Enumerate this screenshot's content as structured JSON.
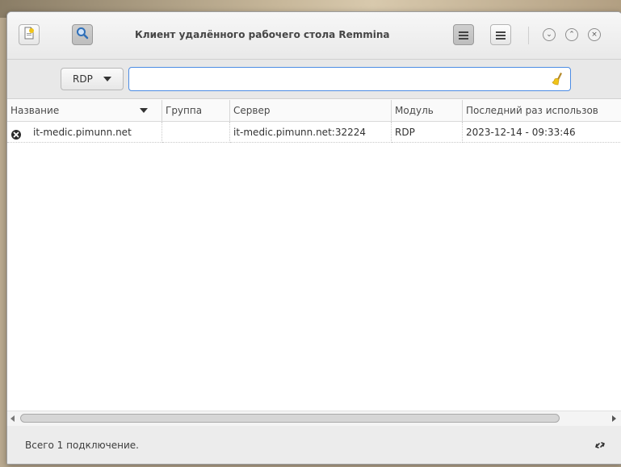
{
  "window": {
    "title": "Клиент удалённого рабочего стола Remmina"
  },
  "headerbar": {
    "new_connection_icon": "new-document-icon",
    "search_toggle_icon": "search-icon",
    "view_toggle_icon": "list-view-icon",
    "menu_icon": "hamburger-menu-icon",
    "minimize_glyph": "⌄",
    "maximize_glyph": "⌃",
    "close_glyph": "×"
  },
  "search": {
    "protocol_selected": "RDP",
    "value": "",
    "placeholder": ""
  },
  "table": {
    "columns": [
      "Название",
      "Группа",
      "Сервер",
      "Модуль",
      "Последний раз использов"
    ],
    "rows": [
      {
        "name": "it-medic.pimunn.net",
        "group": "",
        "server": "it-medic.pimunn.net:32224",
        "plugin": "RDP",
        "last_used": "2023-12-14 - 09:33:46"
      }
    ]
  },
  "status": {
    "text": "Всего 1 подключение."
  },
  "colors": {
    "accent_focus": "#4c8ce4",
    "search_icon_blue": "#2f6fb8",
    "clear_icon_yellow": "#f0c419"
  }
}
